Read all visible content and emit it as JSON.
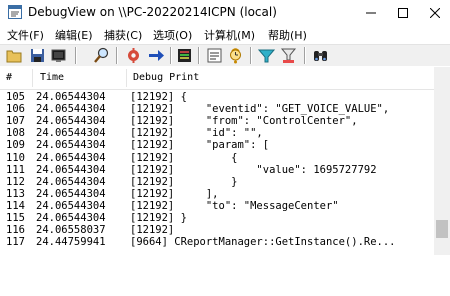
{
  "window": {
    "title": "DebugView on \\\\PC-20220214ICPN (local)"
  },
  "menu": [
    "文件(F)",
    "编辑(E)",
    "捕获(C)",
    "选项(O)",
    "计算机(M)",
    "帮助(H)"
  ],
  "columns": {
    "num": "#",
    "time": "Time",
    "print": "Debug Print"
  },
  "rows": [
    {
      "num": "105",
      "time": "24.06544304",
      "print": "[12192] {"
    },
    {
      "num": "106",
      "time": "24.06544304",
      "print": "[12192]     \"eventid\": \"GET_VOICE_VALUE\","
    },
    {
      "num": "107",
      "time": "24.06544304",
      "print": "[12192]     \"from\": \"ControlCenter\","
    },
    {
      "num": "108",
      "time": "24.06544304",
      "print": "[12192]     \"id\": \"\","
    },
    {
      "num": "109",
      "time": "24.06544304",
      "print": "[12192]     \"param\": ["
    },
    {
      "num": "110",
      "time": "24.06544304",
      "print": "[12192]         {"
    },
    {
      "num": "111",
      "time": "24.06544304",
      "print": "[12192]             \"value\": 1695727792"
    },
    {
      "num": "112",
      "time": "24.06544304",
      "print": "[12192]         }"
    },
    {
      "num": "113",
      "time": "24.06544304",
      "print": "[12192]     ],"
    },
    {
      "num": "114",
      "time": "24.06544304",
      "print": "[12192]     \"to\": \"MessageCenter\""
    },
    {
      "num": "115",
      "time": "24.06544304",
      "print": "[12192] }"
    },
    {
      "num": "116",
      "time": "24.06558037",
      "print": "[12192]"
    },
    {
      "num": "117",
      "time": "24.44759941",
      "print": "[9664] CReportManager::GetInstance().Re..."
    }
  ],
  "colors": {
    "accent": "#0078d7",
    "toolbar_bg": "#f0f0f0"
  }
}
